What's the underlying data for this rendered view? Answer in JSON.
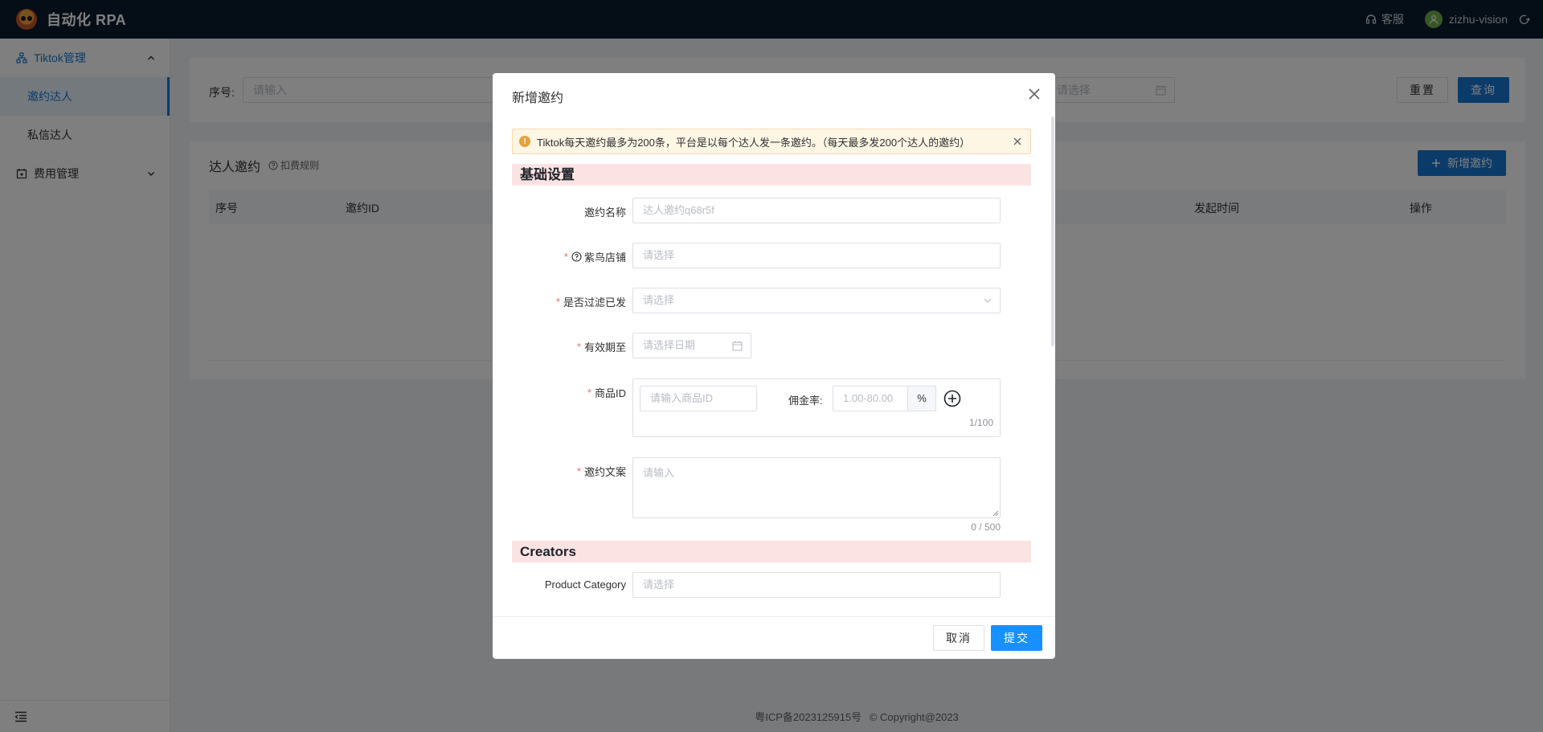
{
  "topbar": {
    "title": "自动化 RPA",
    "support": "客服",
    "username": "zizhu-vision"
  },
  "sidebar": {
    "groups": [
      {
        "label": "Tiktok管理",
        "items": [
          {
            "label": "邀约达人"
          },
          {
            "label": "私信达人"
          }
        ]
      },
      {
        "label": "费用管理"
      }
    ]
  },
  "search": {
    "serial_label": "序号:",
    "serial_placeholder": "请输入",
    "date_placeholder": "请选择",
    "reset": "重置",
    "query": "查询"
  },
  "list": {
    "title": "达人邀约",
    "rules_link": "扣费规则",
    "add_button": "新增邀约",
    "columns": [
      "序号",
      "邀约ID",
      "发起时间",
      "操作"
    ]
  },
  "footer": {
    "icp": "粤ICP备2023125915号",
    "copyright": "Copyright@2023"
  },
  "modal": {
    "title": "新增邀约",
    "alert": "Tiktok每天邀约最多为200条，平台是以每个达人发一条邀约。（每天最多发200个达人的邀约）",
    "section_basic": "基础设置",
    "fields": {
      "name_label": "邀约名称",
      "name_placeholder": "达人邀约q68r5f",
      "shop_label": "紫鸟店铺",
      "shop_placeholder": "请选择",
      "filter_label": "是否过滤已发",
      "filter_placeholder": "请选择",
      "valid_label": "有效期至",
      "valid_placeholder": "请选择日期",
      "product_label": "商品ID",
      "product_placeholder": "请输入商品ID",
      "commission_label": "佣金率:",
      "commission_placeholder": "1.00-80.00",
      "commission_suffix": "%",
      "product_counter": "1/100",
      "copy_label": "邀约文案",
      "copy_placeholder": "请输入",
      "copy_counter": "0 / 500"
    },
    "section_creators": "Creators",
    "creators": {
      "category_label": "Product Category",
      "category_placeholder": "请选择"
    },
    "cancel": "取消",
    "submit": "提交"
  },
  "colors": {
    "primary": "#1677d2",
    "topbar": "#0b1a2c",
    "section_bg": "#fbe3e4",
    "alert_bg": "#fdf6e4",
    "required": "#f56c6c"
  }
}
